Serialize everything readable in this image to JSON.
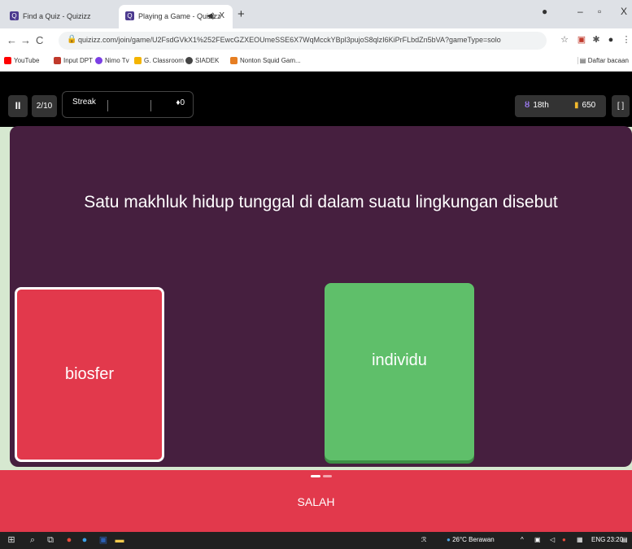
{
  "browser": {
    "tabs": [
      {
        "title": "Find a Quiz - Quizizz",
        "close": "X"
      },
      {
        "title": "Playing a Game - Quizizz",
        "close": "X",
        "audio_icon": "speaker-icon"
      }
    ],
    "new_tab": "+",
    "window_controls": {
      "minimize": "–",
      "maximize": "🗗",
      "close": "X"
    },
    "url": "quizizz.com/join/game/U2FsdGVkX1%252FEwcGZXEOUmeSSE6X7WqMcckYBpl3pujoS8qlzI6KiPrFLbdZn5bVA?gameType=solo",
    "bookmarks": [
      {
        "label": "YouTube",
        "color": "#ff0000"
      },
      {
        "label": "Input DPT",
        "color": "#c0392b"
      },
      {
        "label": "Nimo Tv",
        "color": "#7b3fe4"
      },
      {
        "label": "G. Classroom",
        "color": "#f4b400"
      },
      {
        "label": "SIADEK",
        "color": "#444444"
      },
      {
        "label": "Nonton Squid Gam...",
        "color": "#e67e22"
      }
    ],
    "reading_list": "Daftar bacaan"
  },
  "quiz": {
    "pause_icon": "II",
    "question_counter": "2/10",
    "streak_label": "Streak",
    "streak_value": "0",
    "rank": "18th",
    "score": "650",
    "fullscreen_icon": "[ ]",
    "question": "Satu makhluk hidup tunggal di dalam suatu lingkungan disebut",
    "answers": [
      {
        "text": "biosfer",
        "state": "selected-wrong",
        "color": "#e2394c"
      },
      {
        "text": "individu",
        "state": "correct",
        "color": "#5fbf6a"
      }
    ],
    "result": "SALAH",
    "colors": {
      "panel": "#461f3f",
      "wrong": "#e2394c",
      "correct": "#5fbf6a",
      "topbar": "#000000"
    }
  },
  "taskbar": {
    "weather": "26°C Berawan",
    "language": "ENG",
    "time": "23:20"
  }
}
